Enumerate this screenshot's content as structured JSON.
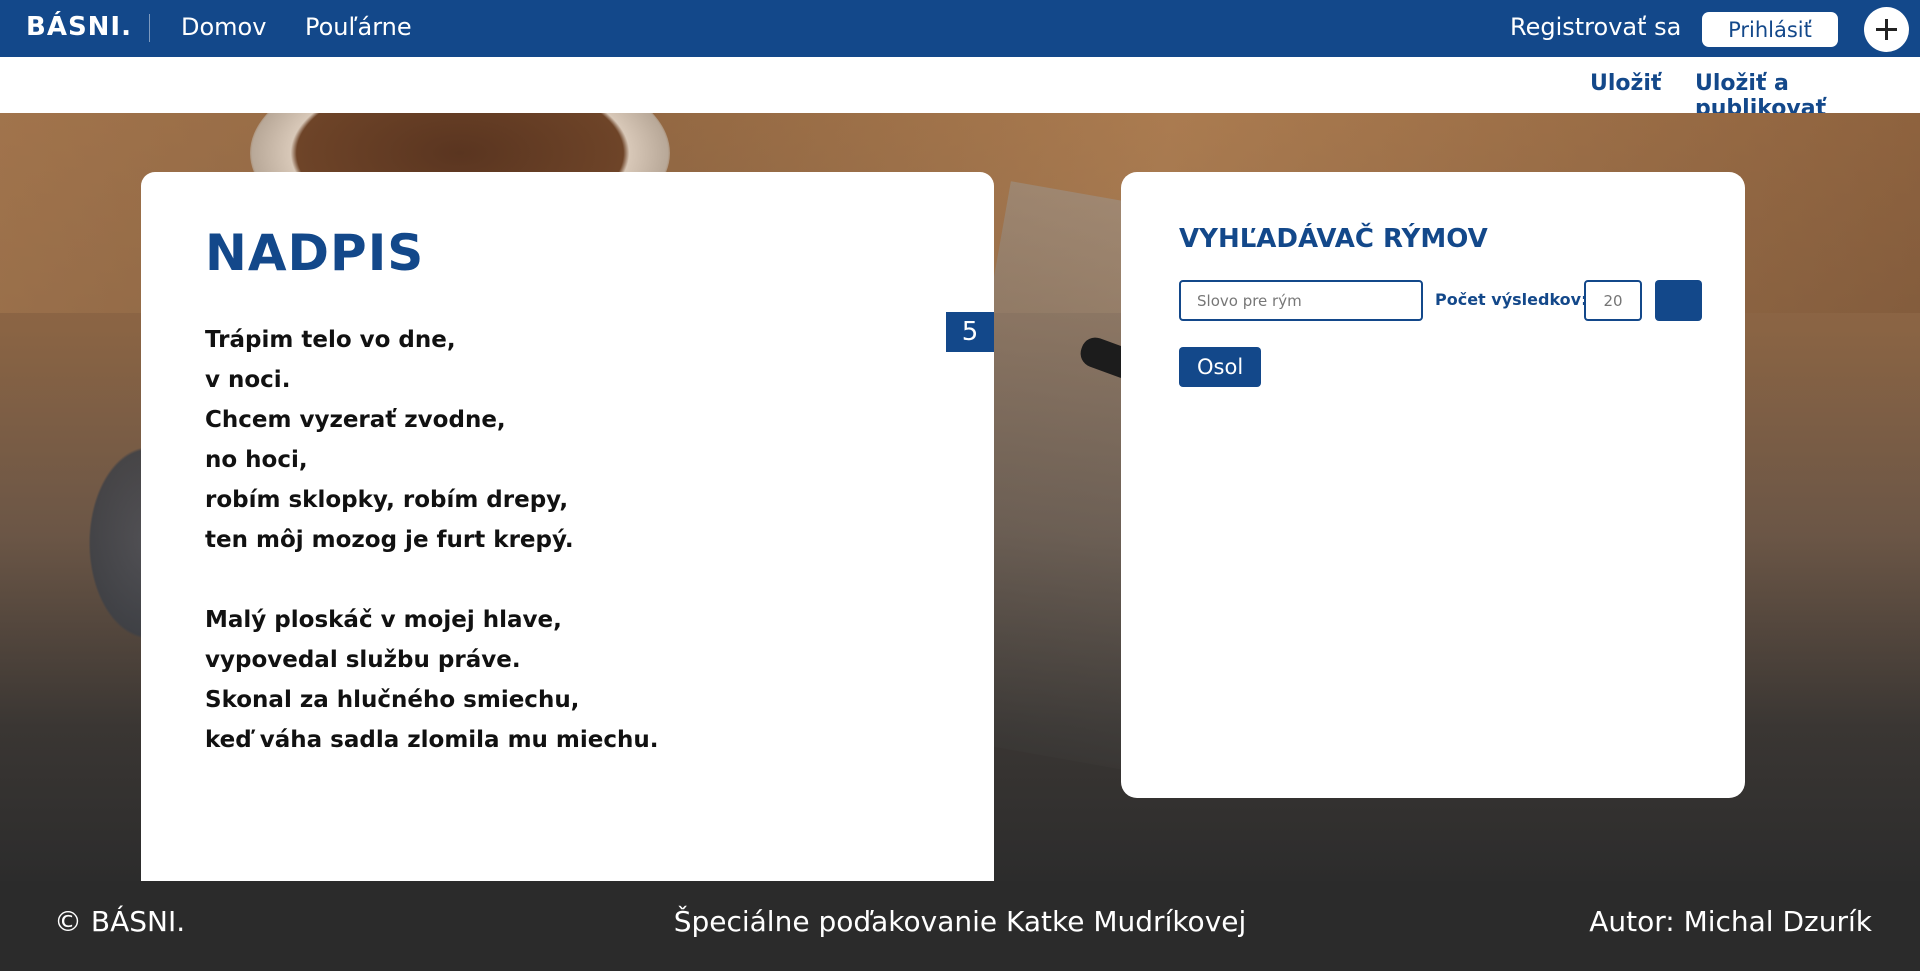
{
  "nav": {
    "brand": "BÁSNI.",
    "home": "Domov",
    "popular": "Pouľárne",
    "register": "Registrovať sa",
    "login": "Prihlásiť"
  },
  "actions": {
    "save": "Uložiť",
    "save_publish": "Uložiť a publikovať"
  },
  "poem": {
    "title": "NADPIS",
    "syllable_count": "5",
    "stanzas": [
      [
        "Trápim telo vo dne,",
        "v noci.",
        "Chcem vyzerať zvodne,",
        "no hoci,",
        "robím sklopky, robím drepy,",
        "ten môj mozog je furt krepý."
      ],
      [
        "Malý ploskáč v mojej hlave,",
        "vypovedal službu práve.",
        "Skonal za hlučného smiechu,",
        "keď váha sadla zlomila mu miechu."
      ]
    ]
  },
  "rhyme": {
    "title": "VYHĽADÁVAČ RÝMOV",
    "input_placeholder": "Slovo pre rým",
    "count_label": "Počet výsledkov:",
    "count_value": "20",
    "results": [
      "Osol"
    ]
  },
  "footer": {
    "copyright": "© BÁSNI.",
    "thanks": "Špeciálne poďakovanie Katke Mudríkovej",
    "author": "Autor: Michal Dzurík"
  },
  "colors": {
    "primary": "#13488a",
    "footer_bg": "#2b2b2b"
  }
}
